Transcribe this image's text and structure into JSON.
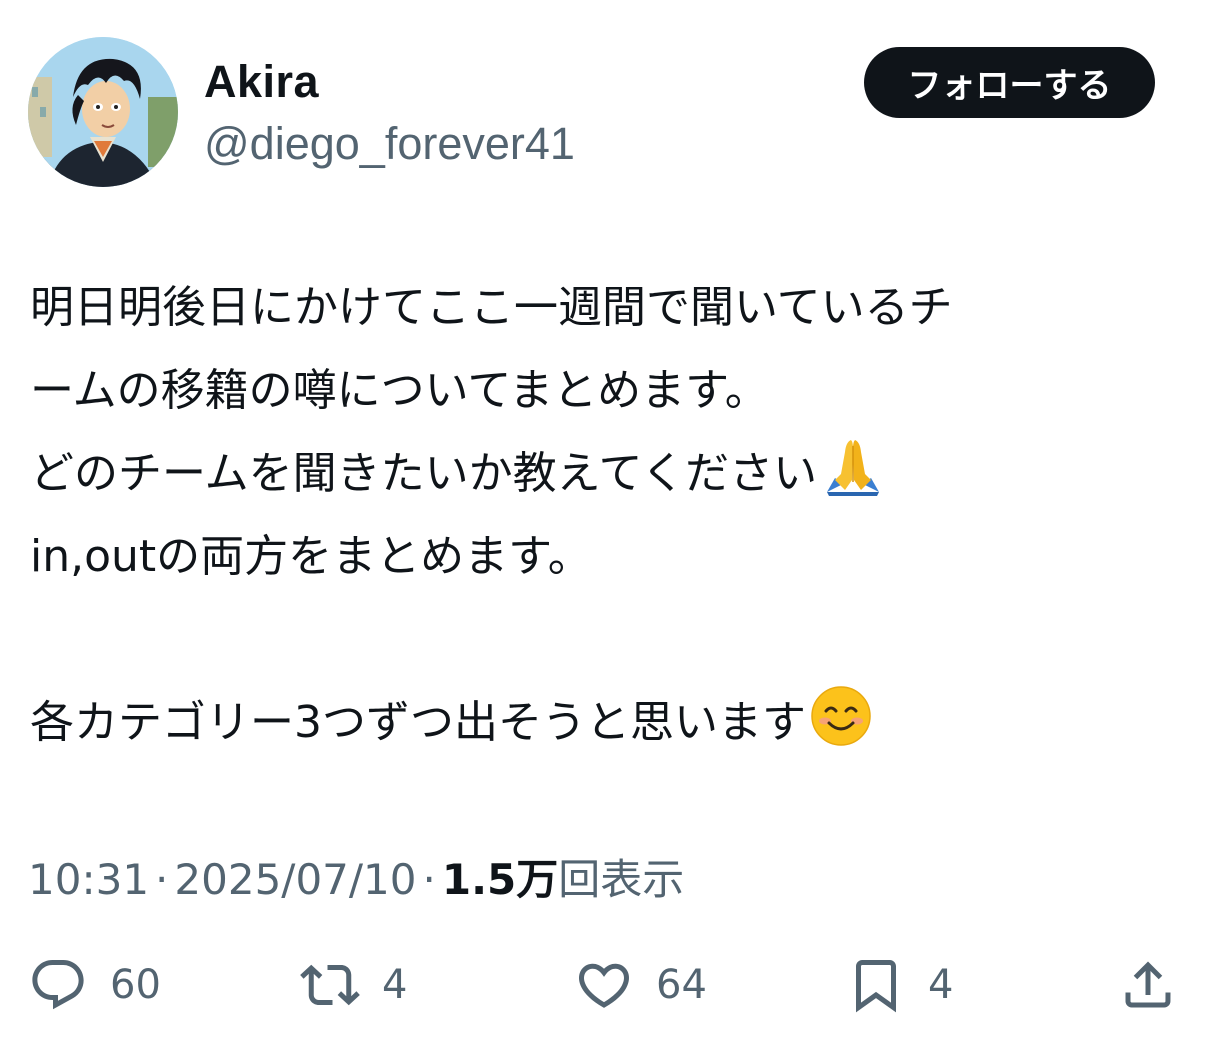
{
  "user": {
    "display_name": "Akira",
    "handle": "@diego_forever41"
  },
  "follow_button": {
    "label": "フォローする"
  },
  "post": {
    "lines": [
      "明日明後日にかけてここ一週間で聞いているチ",
      "ームの移籍の噂についてまとめます。",
      "どのチームを聞きたいか教えてください",
      "in,outの両方をまとめます。",
      "",
      "各カテゴリー3つずつ出そうと思います"
    ],
    "emojis": [
      "folded-hands",
      "smiling-face"
    ]
  },
  "meta": {
    "time": "10:31",
    "date": "2025/07/10",
    "views_count": "1.5万",
    "views_label": "回表示",
    "separator": "·"
  },
  "actions": {
    "replies": "60",
    "reposts": "4",
    "likes": "64",
    "bookmarks": "4"
  },
  "colors": {
    "text": "#0f1419",
    "secondary": "#536471",
    "button_bg": "#0f1419",
    "button_text": "#ffffff"
  }
}
